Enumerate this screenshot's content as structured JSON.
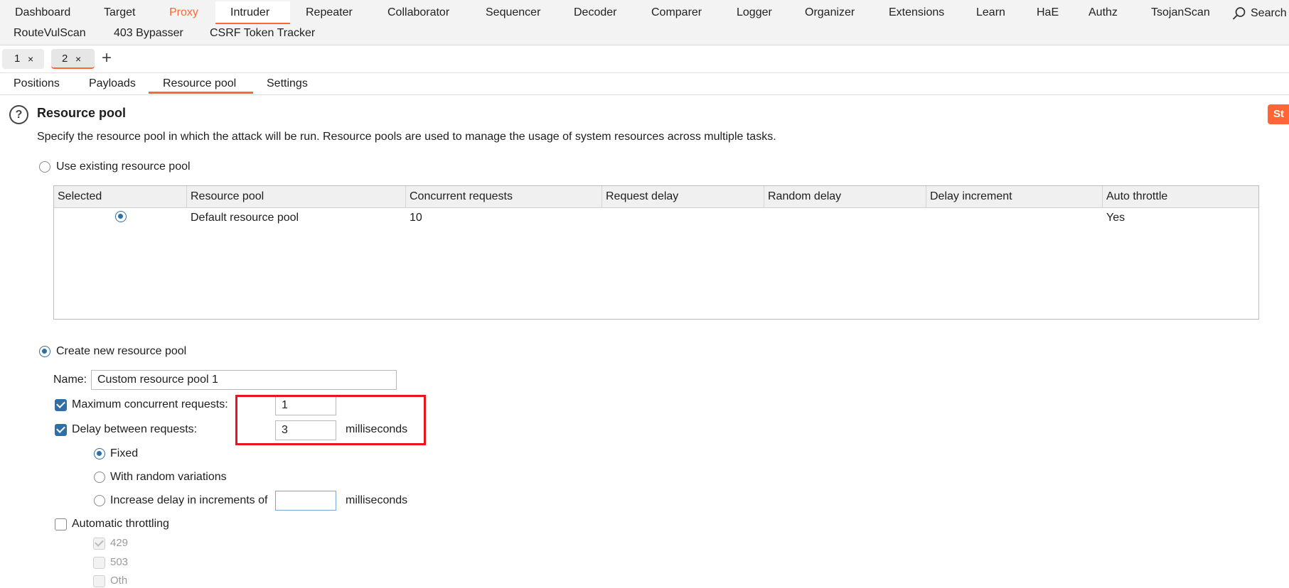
{
  "nav": {
    "row1": [
      "Dashboard",
      "Target",
      "Proxy",
      "Intruder",
      "Repeater",
      "Collaborator",
      "Sequencer",
      "Decoder",
      "Comparer",
      "Logger",
      "Organizer",
      "Extensions",
      "Learn",
      "HaE",
      "Authz",
      "TsojanScan"
    ],
    "search": "Search",
    "row2": [
      "RouteVulScan",
      "403 Bypasser",
      "CSRF Token Tracker"
    ]
  },
  "tabs": {
    "tab1": "1",
    "tab2": "2",
    "close": "×",
    "add": "+"
  },
  "subtabs": [
    "Positions",
    "Payloads",
    "Resource pool",
    "Settings"
  ],
  "section": {
    "title": "Resource pool",
    "description": "Specify the resource pool in which the attack will be run. Resource pools are used to manage the usage of system resources across multiple tasks.",
    "start_button": "St"
  },
  "existing": {
    "label": "Use existing resource pool",
    "columns": [
      "Selected",
      "Resource pool",
      "Concurrent requests",
      "Request delay",
      "Random delay",
      "Delay increment",
      "Auto throttle"
    ],
    "rows": [
      {
        "pool": "Default resource pool",
        "concurrent": "10",
        "request_delay": "",
        "random_delay": "",
        "delay_increment": "",
        "auto_throttle": "Yes"
      }
    ]
  },
  "create": {
    "label": "Create new resource pool",
    "name_label": "Name:",
    "name_value": "Custom resource pool 1",
    "max_concurrent_label": "Maximum concurrent requests:",
    "max_concurrent_value": "1",
    "delay_label": "Delay between requests:",
    "delay_value": "3",
    "ms": "milliseconds",
    "fixed": "Fixed",
    "random": "With random variations",
    "increase": "Increase delay in increments of",
    "increase_value": "",
    "auto_throttle": "Automatic throttling",
    "codes": [
      "429",
      "503",
      "Oth"
    ]
  },
  "colors": {
    "accent": "#ff6633",
    "selection": "#2e6fa8",
    "highlight": "#e8161c"
  }
}
